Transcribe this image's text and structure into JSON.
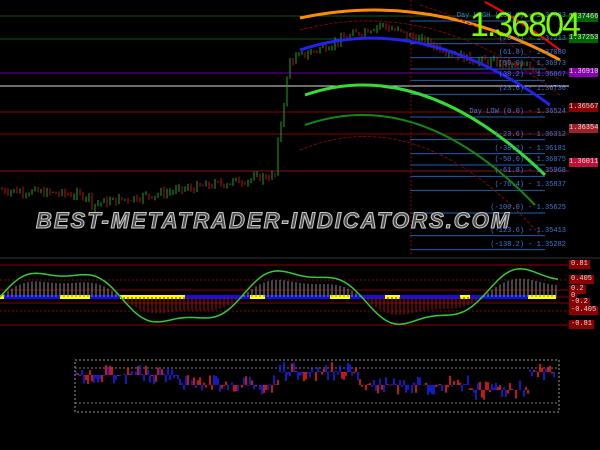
{
  "current_price": "1.36804",
  "watermark": "BEST-METATRADER-INDICATORS.COM",
  "fib_levels": [
    {
      "label": "Day HIGH (100.0) - 1.37483",
      "pct": 100
    },
    {
      "label": "(76.4) - 1.37213",
      "pct": 76.4
    },
    {
      "label": "(61.8) - 1.37080",
      "pct": 61.8
    },
    {
      "label": "(50.0) - 1.36973",
      "pct": 50
    },
    {
      "label": "(38.2) - 1.36867",
      "pct": 38.2
    },
    {
      "label": "(23.6) - 1.36736",
      "pct": 23.6
    },
    {
      "label": "Day LOW (0.0) - 1.36524",
      "pct": 0
    },
    {
      "label": "(-23.6) - 1.36312",
      "pct": -23.6
    },
    {
      "label": "(-38.2) - 1.36181",
      "pct": -38.2
    },
    {
      "label": "(-50.0) - 1.36075",
      "pct": -50
    },
    {
      "label": "(-61.8) - 1.35968",
      "pct": -61.8
    },
    {
      "label": "(-76.4) - 1.35837",
      "pct": -76.4
    },
    {
      "label": "(-100.0) - 1.35625",
      "pct": -100
    },
    {
      "label": "(-123.6) - 1.35413",
      "pct": -123.6
    },
    {
      "label": "(-138.2) - 1.35282",
      "pct": -138.2
    }
  ],
  "price_tags": [
    {
      "value": "1.37466",
      "color": "#006400"
    },
    {
      "value": "1.37253",
      "color": "#006400"
    },
    {
      "value": "1.36910",
      "color": "#8b00b0"
    },
    {
      "value": "1.36567",
      "color": "#8b0000"
    },
    {
      "value": "1.36354",
      "color": "#a0202a"
    },
    {
      "value": "1.36011",
      "color": "#c0103a"
    }
  ],
  "oscillator_levels": [
    "0.81",
    "0.405",
    "0.2",
    "0",
    "-0.2",
    "-0.405",
    "-0.81"
  ]
}
